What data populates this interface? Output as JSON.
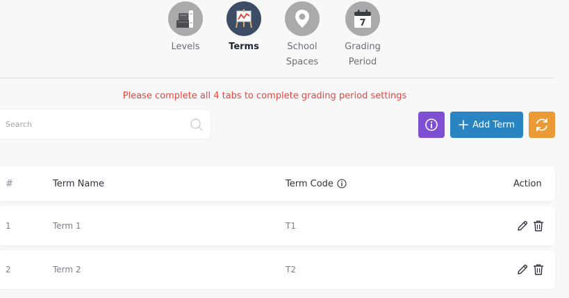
{
  "tabs": [
    {
      "label": "Levels",
      "icon": "books-icon",
      "active": false
    },
    {
      "label": "Terms",
      "icon": "easel-chart-icon",
      "active": true
    },
    {
      "label": "School\nSpaces",
      "icon": "map-pin-icon",
      "active": false
    },
    {
      "label": "Grading\nPeriod",
      "icon": "calendar-icon",
      "active": false,
      "calendar_day": "7"
    }
  ],
  "notice": "Please complete all 4 tabs to complete grading period settings",
  "search": {
    "placeholder": "Search",
    "value": ""
  },
  "buttons": {
    "info": "info-icon",
    "add_label": "Add Term",
    "refresh": "refresh-icon"
  },
  "table": {
    "columns": {
      "num": "#",
      "name": "Term Name",
      "code": "Term Code",
      "action": "Action"
    },
    "rows": [
      {
        "num": "1",
        "name": "Term 1",
        "code": "T1"
      },
      {
        "num": "2",
        "name": "Term 2",
        "code": "T2"
      }
    ]
  },
  "colors": {
    "active_tab": "#3e4d66",
    "inactive_tab": "#a9aaab",
    "notice": "#e8443c",
    "info_button": "#7e4fd3",
    "add_button": "#2a84c2",
    "refresh_button": "#ec9a36"
  }
}
